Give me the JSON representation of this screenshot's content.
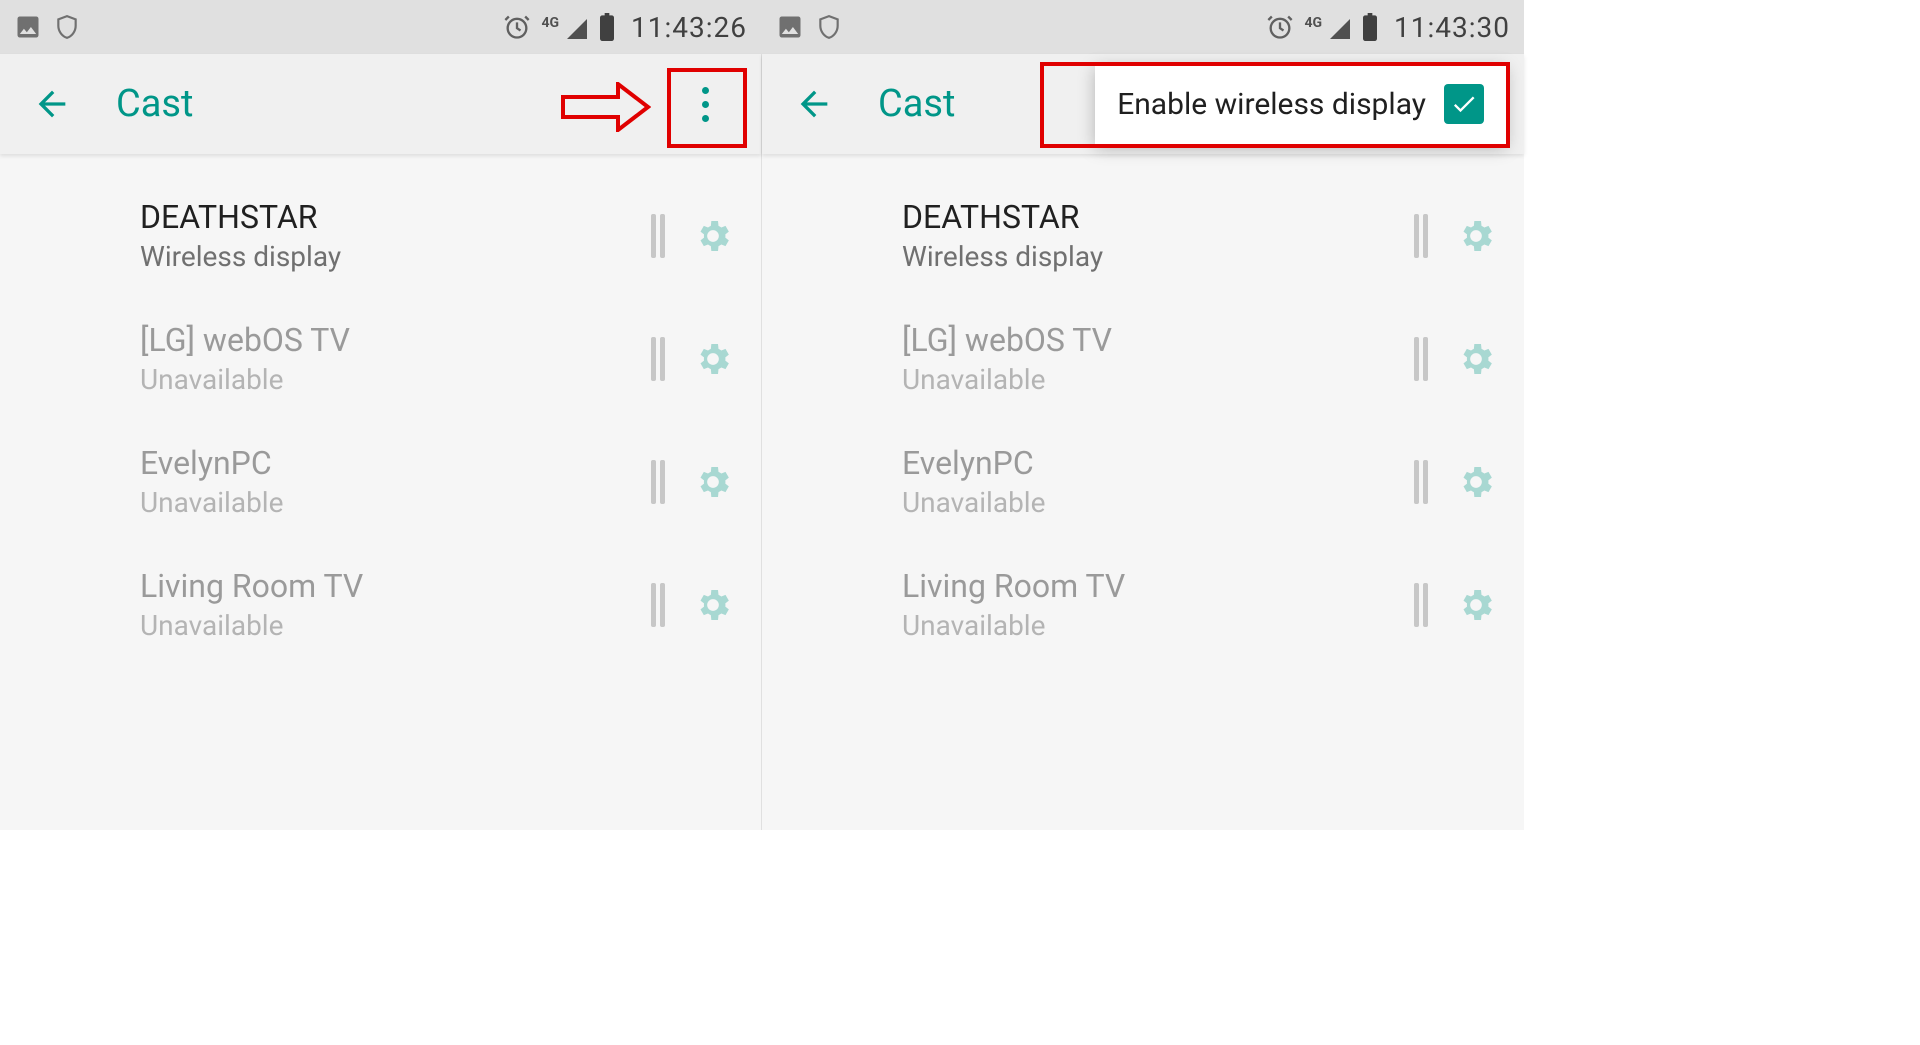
{
  "statusbar": {
    "network_label": "4G",
    "time_left": "11:43:26",
    "time_right": "11:43:30"
  },
  "appbar": {
    "title": "Cast"
  },
  "popup": {
    "label": "Enable wireless display",
    "checked": true
  },
  "devices": [
    {
      "name": "DEATHSTAR",
      "sub": "Wireless display",
      "active": true
    },
    {
      "name": "[LG] webOS TV",
      "sub": "Unavailable",
      "active": false
    },
    {
      "name": "EvelynPC",
      "sub": "Unavailable",
      "active": false
    },
    {
      "name": "Living Room TV",
      "sub": "Unavailable",
      "active": false
    }
  ]
}
